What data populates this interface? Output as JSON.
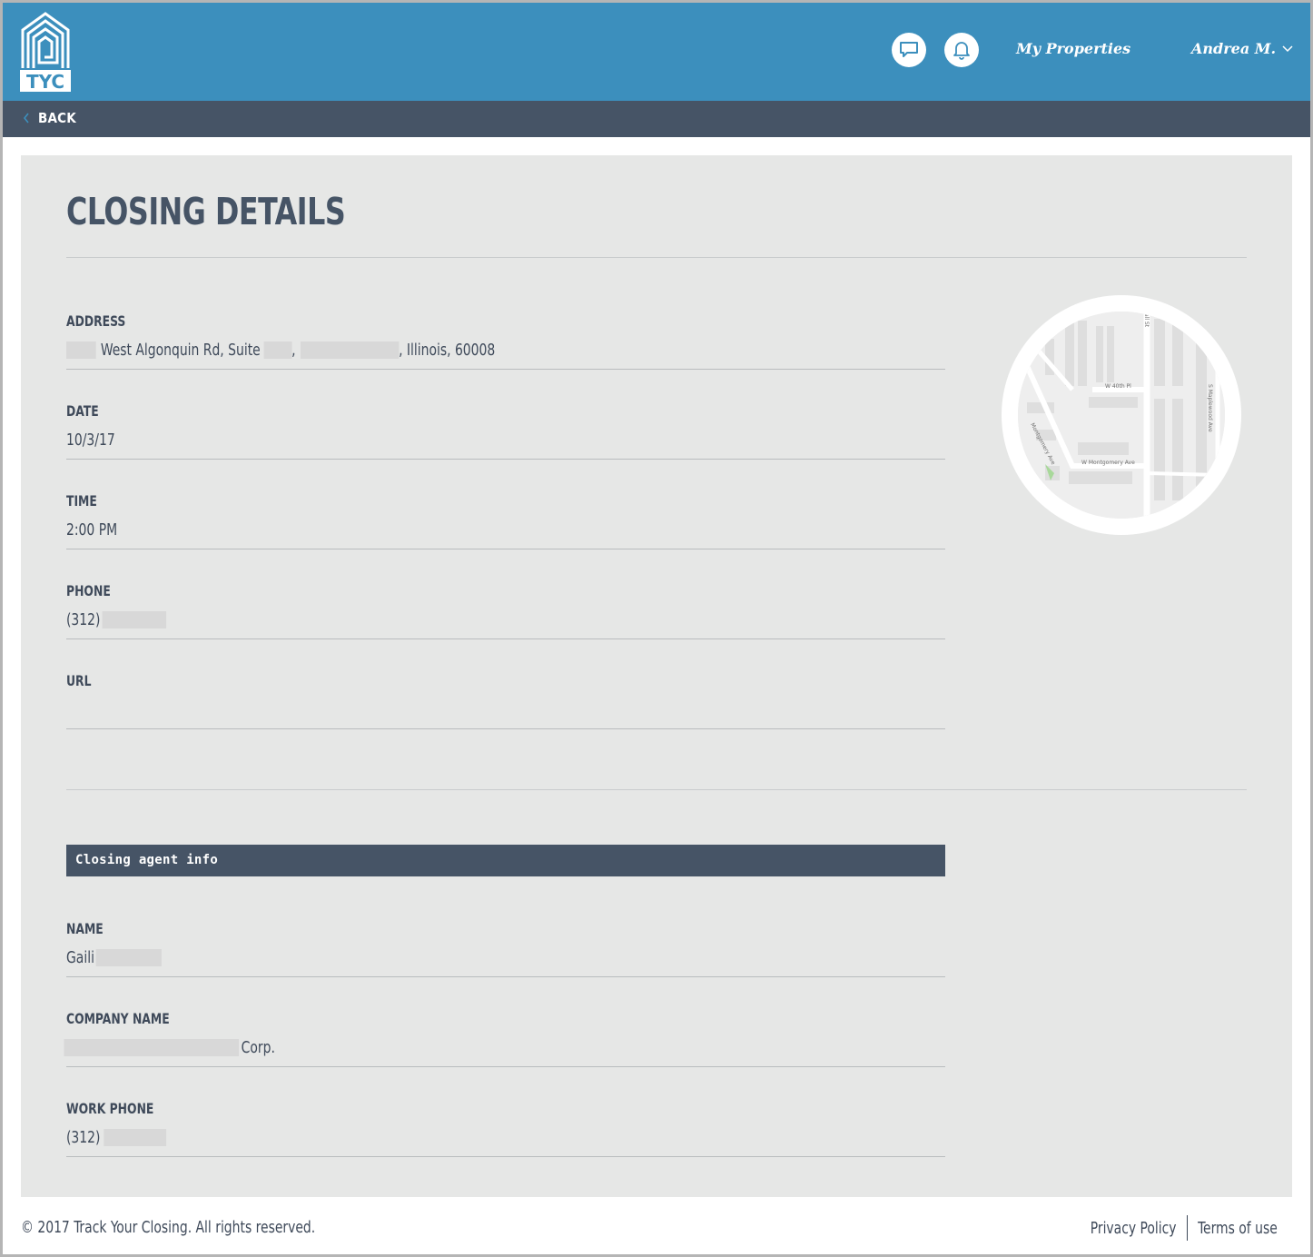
{
  "header": {
    "logo_text": "TYC",
    "my_properties": "My Properties",
    "user_name": "Andrea M."
  },
  "nav": {
    "back_label": "BACK"
  },
  "page": {
    "title": "CLOSING DETAILS"
  },
  "details": {
    "address": {
      "label": "ADDRESS",
      "part1": "West Algonquin Rd, Suite",
      "comma": ",",
      "part2": ", Illinois, 60008"
    },
    "date": {
      "label": "DATE",
      "value": "10/3/17"
    },
    "time": {
      "label": "TIME",
      "value": "2:00 PM"
    },
    "phone": {
      "label": "PHONE",
      "value": "(312)"
    },
    "url": {
      "label": "URL",
      "value": ""
    }
  },
  "map": {
    "streets": [
      "W 40th Pl",
      "W Montgomery Ave",
      "S Maplewood Ave",
      "Montgomery Ave",
      "all St"
    ]
  },
  "agent": {
    "section_title": "Closing agent info",
    "name": {
      "label": "NAME",
      "value": "Gaili"
    },
    "company": {
      "label": "COMPANY NAME",
      "value": "Corp."
    },
    "work_phone": {
      "label": "WORK PHONE",
      "value": "(312)"
    }
  },
  "footer": {
    "copyright": "© 2017 Track Your Closing. All rights reserved.",
    "privacy": "Privacy Policy",
    "terms": "Terms of use"
  },
  "colors": {
    "header_bg": "#3c8fbd",
    "nav_bg": "#465466",
    "panel_bg": "#e6e7e6",
    "text": "#3f4a5a"
  }
}
